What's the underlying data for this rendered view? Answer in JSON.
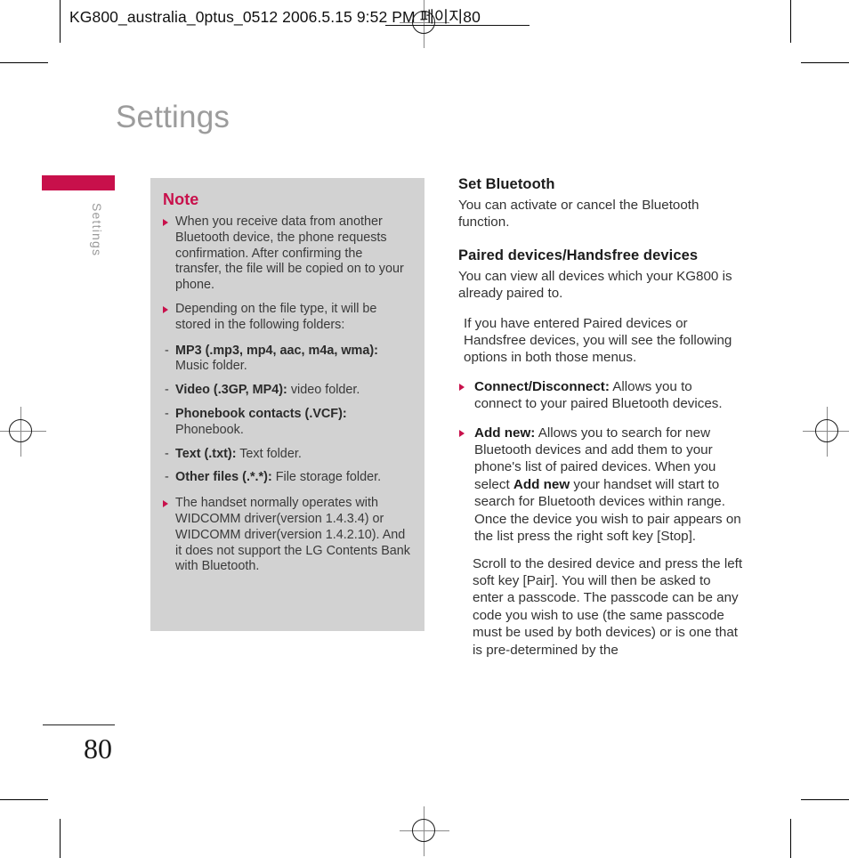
{
  "running_head": "KG800_australia_0ptus_0512  2006.5.15 9:52 PM  페이지80",
  "chapter": {
    "title": "Settings",
    "tab_label": "Settings",
    "accent_color": "#c8104b"
  },
  "note_box": {
    "title": "Note",
    "bullets": [
      "When you receive data from another Bluetooth device, the phone requests confirmation. After confirming the transfer, the file will be copied on to your phone.",
      "Depending on the file type, it will be stored in the following folders:"
    ],
    "file_types": [
      {
        "label": "MP3 (.mp3, mp4, aac, m4a, wma):",
        "value": " Music folder."
      },
      {
        "label": "Video (.3GP, MP4):",
        "value": " video folder."
      },
      {
        "label": "Phonebook contacts (.VCF):",
        "value": " Phonebook."
      },
      {
        "label": "Text (.txt):",
        "value": " Text folder."
      },
      {
        "label": "Other files (.*.*):",
        "value": " File storage folder."
      }
    ],
    "final_bullet": "The handset normally operates with WIDCOMM driver(version 1.4.3.4) or WIDCOMM driver(version 1.4.2.10). And it does not support the LG Contents Bank with Bluetooth."
  },
  "right_column": {
    "heading_1": "Set Bluetooth",
    "para_1": "You can activate or cancel the Bluetooth function.",
    "heading_2": "Paired devices/Handsfree devices",
    "para_2": "You can view all devices which your KG800 is already paired to.",
    "para_3": "If you have entered Paired devices or Handsfree devices, you will see the following options in both those menus.",
    "bullets": [
      {
        "label": "Connect/Disconnect:",
        "text": " Allows you to connect to your paired Bluetooth devices."
      },
      {
        "label": "Add new:",
        "text_before": " Allows you to search for new Bluetooth devices and add them to your phone's list of paired devices. When you select ",
        "emphasis": "Add new",
        "text_after": " your handset will start to search for Bluetooth devices within range. Once the device you wish to pair appears on the list press the right soft key [Stop]."
      }
    ],
    "para_4": "Scroll to the desired device and press the left soft key [Pair]. You will then be asked to enter a passcode. The passcode can be any code you wish to use (the same passcode must be used by both devices) or is one that is pre-determined by the"
  },
  "folio": {
    "page_number": "80"
  }
}
